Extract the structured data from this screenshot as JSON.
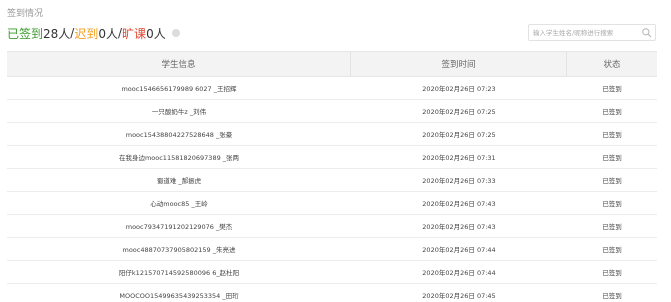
{
  "section_title": "签到情况",
  "summary": {
    "signed_label": "已签到",
    "signed_value": "28人",
    "sep1": "/",
    "late_label": "迟到",
    "late_value": "0人",
    "sep2": "/",
    "absent_label": "旷课",
    "absent_value": "0人"
  },
  "search": {
    "placeholder": "输入学生姓名/昵称进行搜索",
    "value": ""
  },
  "table": {
    "headers": [
      "学生信息",
      "签到时间",
      "状态"
    ],
    "rows": [
      {
        "student": "mooc1546656179989 6027 _王招辉",
        "time": "2020年02月26日 07:23",
        "status": "已签到"
      },
      {
        "student": "一只酸奶牛z _刘伟",
        "time": "2020年02月26日 07:25",
        "status": "已签到"
      },
      {
        "student": "mooc15438804227528648 _张豪",
        "time": "2020年02月26日 07:25",
        "status": "已签到"
      },
      {
        "student": "在我身边mooc11581820697389 _张两",
        "time": "2020年02月26日 07:31",
        "status": "已签到"
      },
      {
        "student": "蜀道难 _郝振虎",
        "time": "2020年02月26日 07:33",
        "status": "已签到"
      },
      {
        "student": "心动mooc85 _王岭",
        "time": "2020年02月26日 07:43",
        "status": "已签到"
      },
      {
        "student": "mooc79347191202129076 _樊杰",
        "time": "2020年02月26日 07:43",
        "status": "已签到"
      },
      {
        "student": "mooc48870737905802159 _朱亮进",
        "time": "2020年02月26日 07:44",
        "status": "已签到"
      },
      {
        "student": "阳仔k121570714592580096 6_赵杜阳",
        "time": "2020年02月26日 07:44",
        "status": "已签到"
      },
      {
        "student": "MOOCOO15499635439253354 _田珩",
        "time": "2020年02月26日 07:45",
        "status": "已签到"
      }
    ]
  },
  "colors": {
    "signed": "#3a9a2a",
    "late": "#f0a020",
    "absent": "#e0452b"
  },
  "icons": [
    "info-dot-icon",
    "search-icon"
  ]
}
